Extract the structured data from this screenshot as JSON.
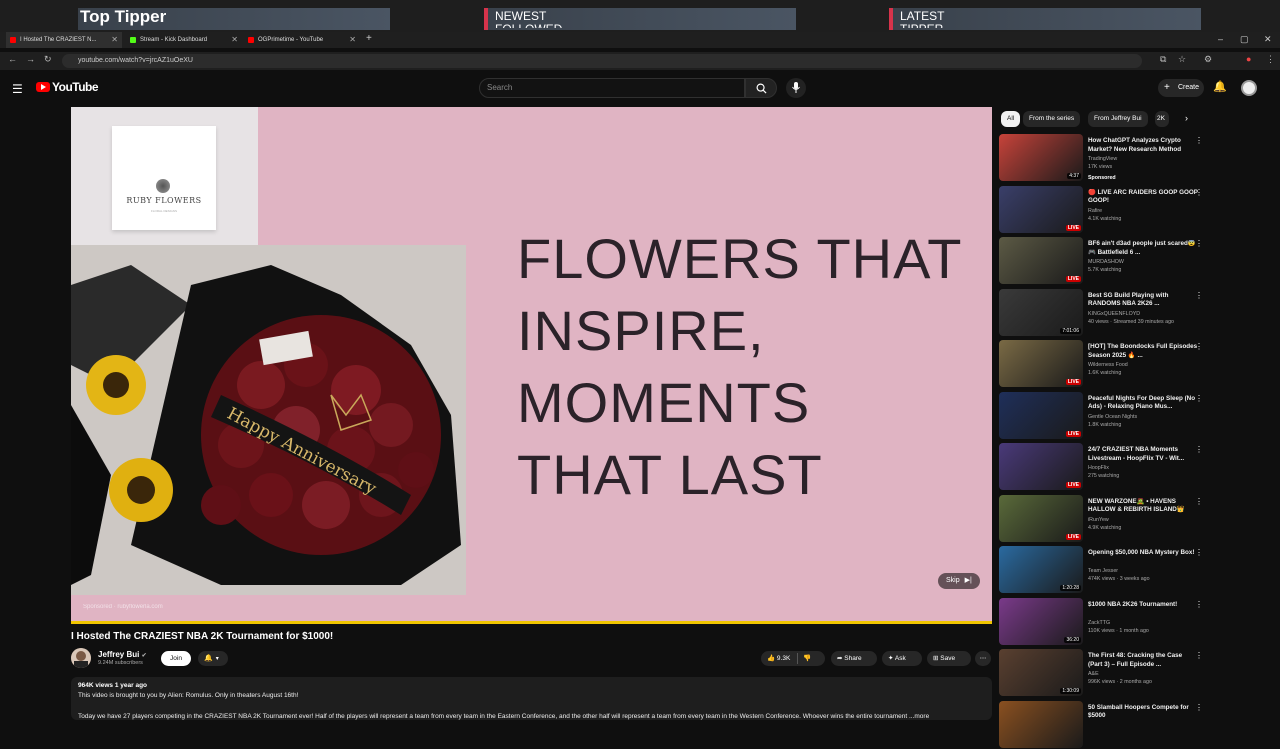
{
  "stream_overlay": {
    "top_tipper": "Top Tipper",
    "newest_followed": "NEWEST FOLLOWED",
    "latest_tipper": "LATEST TIPPER"
  },
  "browser": {
    "tabs": [
      {
        "label": "I Hosted The CRAZIEST N..."
      },
      {
        "label": "Stream - Kick Dashboard"
      },
      {
        "label": "OGPrimetime - YouTube"
      }
    ],
    "url": "youtube.com/watch?v=jrcAZ1uOeXU"
  },
  "header": {
    "logo_text": "YouTube",
    "search_placeholder": "Search",
    "create_label": "Create"
  },
  "ad": {
    "brand": "RUBY FLOWERS",
    "brand_sub": "FLORAL DESIGNS",
    "ribbon_text": "Happy Anniversary",
    "headline_lines": [
      "FLOWERS THAT",
      "INSPIRE,",
      "MOMENTS",
      "THAT LAST"
    ],
    "sponsored": "Sponsored · rubyflowerla.com",
    "skip_label": "Skip"
  },
  "video": {
    "title": "I Hosted The CRAZIEST NBA 2K Tournament for $1000!",
    "channel": "Jeffrey Bui",
    "subscribers": "9.24M subscribers",
    "join_label": "Join",
    "likes": "9.3K",
    "share_label": "Share",
    "ask_label": "Ask",
    "save_label": "Save",
    "meta": "964K views  1 year ago",
    "desc_line1": "This video is brought to you by Alien: Romulus. Only in theaters August 16th!",
    "desc_line2": "Today we have 27 players competing in the CRAZIEST NBA 2K Tournament ever! Half of the players will represent a team from every team in the Eastern Conference, and the other half will represent a team from every team in the Western Conference. Whoever wins the entire tournament ...more"
  },
  "chips": [
    "All",
    "From the series",
    "From Jeffrey Bui",
    "2K"
  ],
  "recommendations": [
    {
      "title": "How ChatGPT Analyzes Crypto Market? New Research Method",
      "channel": "TradingView",
      "views": "17K views",
      "badge": "4:37",
      "sponsored": "Sponsored",
      "thumb": "#c7433a"
    },
    {
      "title": "🔴 LIVE ARC RAIDERS GOOP GOOP GOOP!",
      "channel": "Rafire",
      "views": "4.1K watching",
      "badge": "LIVE",
      "thumb": "#3a3f6a"
    },
    {
      "title": "BF6 ain't d3ad people just scared😨 🎮 Battlefield 6 ...",
      "channel": "MURDASHOW",
      "views": "5.7K watching",
      "badge": "LIVE",
      "thumb": "#5c5a45"
    },
    {
      "title": "Best SG Build Playing with RANDOMS NBA 2K26 ...",
      "channel": "KINGxQUEENFLOYD",
      "views": "40 views · Streamed 39 minutes ago",
      "badge": "7:01:06",
      "thumb": "#3a3a3a"
    },
    {
      "title": "[HOT] The Boondocks Full Episodes Season 2025 🔥 ...",
      "channel": "Wilderness Food",
      "views": "1.6K watching",
      "badge": "LIVE",
      "thumb": "#7a6a45"
    },
    {
      "title": "Peaceful Nights For Deep Sleep (No Ads) - Relaxing Piano Mus...",
      "channel": "Gentle Ocean Nights",
      "views": "1.8K watching",
      "badge": "LIVE",
      "thumb": "#1f2f5a"
    },
    {
      "title": "24/7 CRAZIEST NBA Moments Livestream - HoopFlix TV - Wit...",
      "channel": "HoopFlix",
      "views": "275 watching",
      "badge": "LIVE",
      "thumb": "#4a3a7a"
    },
    {
      "title": "NEW WARZONE🧟 • HAVENS HALLOW & REBIRTH ISLAND👑",
      "channel": "iRunYew",
      "views": "4.9K watching",
      "badge": "LIVE",
      "thumb": "#5a6a3a"
    },
    {
      "title": "Opening $50,000 NBA Mystery Box!",
      "channel": "Team Jesser",
      "views": "474K views · 3 weeks ago",
      "badge": "1:20:28",
      "thumb": "#2a6aa0"
    },
    {
      "title": "$1000 NBA 2K26 Tournament!",
      "channel": "ZackTTG",
      "views": "110K views · 1 month ago",
      "badge": "36:20",
      "thumb": "#7a3a8a"
    },
    {
      "title": "The First 48: Cracking the Case (Part 3) – Full Episode ...",
      "channel": "A&E",
      "views": "996K views · 2 months ago",
      "badge": "1:30:09",
      "thumb": "#5a4030"
    },
    {
      "title": "50 Slamball Hoopers Compete for $5000",
      "channel": "",
      "views": "",
      "badge": "",
      "thumb": "#8a5020"
    }
  ]
}
